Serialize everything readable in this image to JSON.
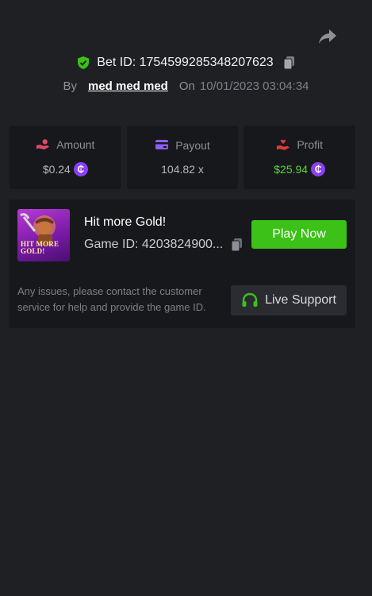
{
  "header": {
    "share_icon": "share-arrow-icon",
    "bet_id_label": "Bet ID: 1754599285348207623",
    "by_label": "By",
    "username": "med med med",
    "on_label": "On",
    "timestamp": "10/01/2023 03:04:34"
  },
  "stats": [
    {
      "label": "Amount",
      "value": "$0.24",
      "icon": "hand-coins-icon",
      "icon_color": "#e0476a",
      "coin": "₵"
    },
    {
      "label": "Payout",
      "value": "104.82 x",
      "icon": "card-icon",
      "icon_color": "#8b5cf6"
    },
    {
      "label": "Profit",
      "value": "$25.94",
      "icon": "hand-heart-icon",
      "icon_color": "#e03a3a",
      "coin": "₵",
      "value_color": "#58d43c"
    }
  ],
  "game": {
    "thumbnail_text": "HIT MORE GOLD!",
    "title": "Hit more Gold!",
    "game_id": "Game ID: 4203824900...",
    "play_label": "Play Now",
    "notice": "Any issues, please contact the customer service for help and provide the game ID.",
    "support_label": "Live Support"
  },
  "colors": {
    "background": "#1f2024",
    "card": "#17181b",
    "accent_green": "#3bc117",
    "coin_purple": "#8b3ff3"
  }
}
